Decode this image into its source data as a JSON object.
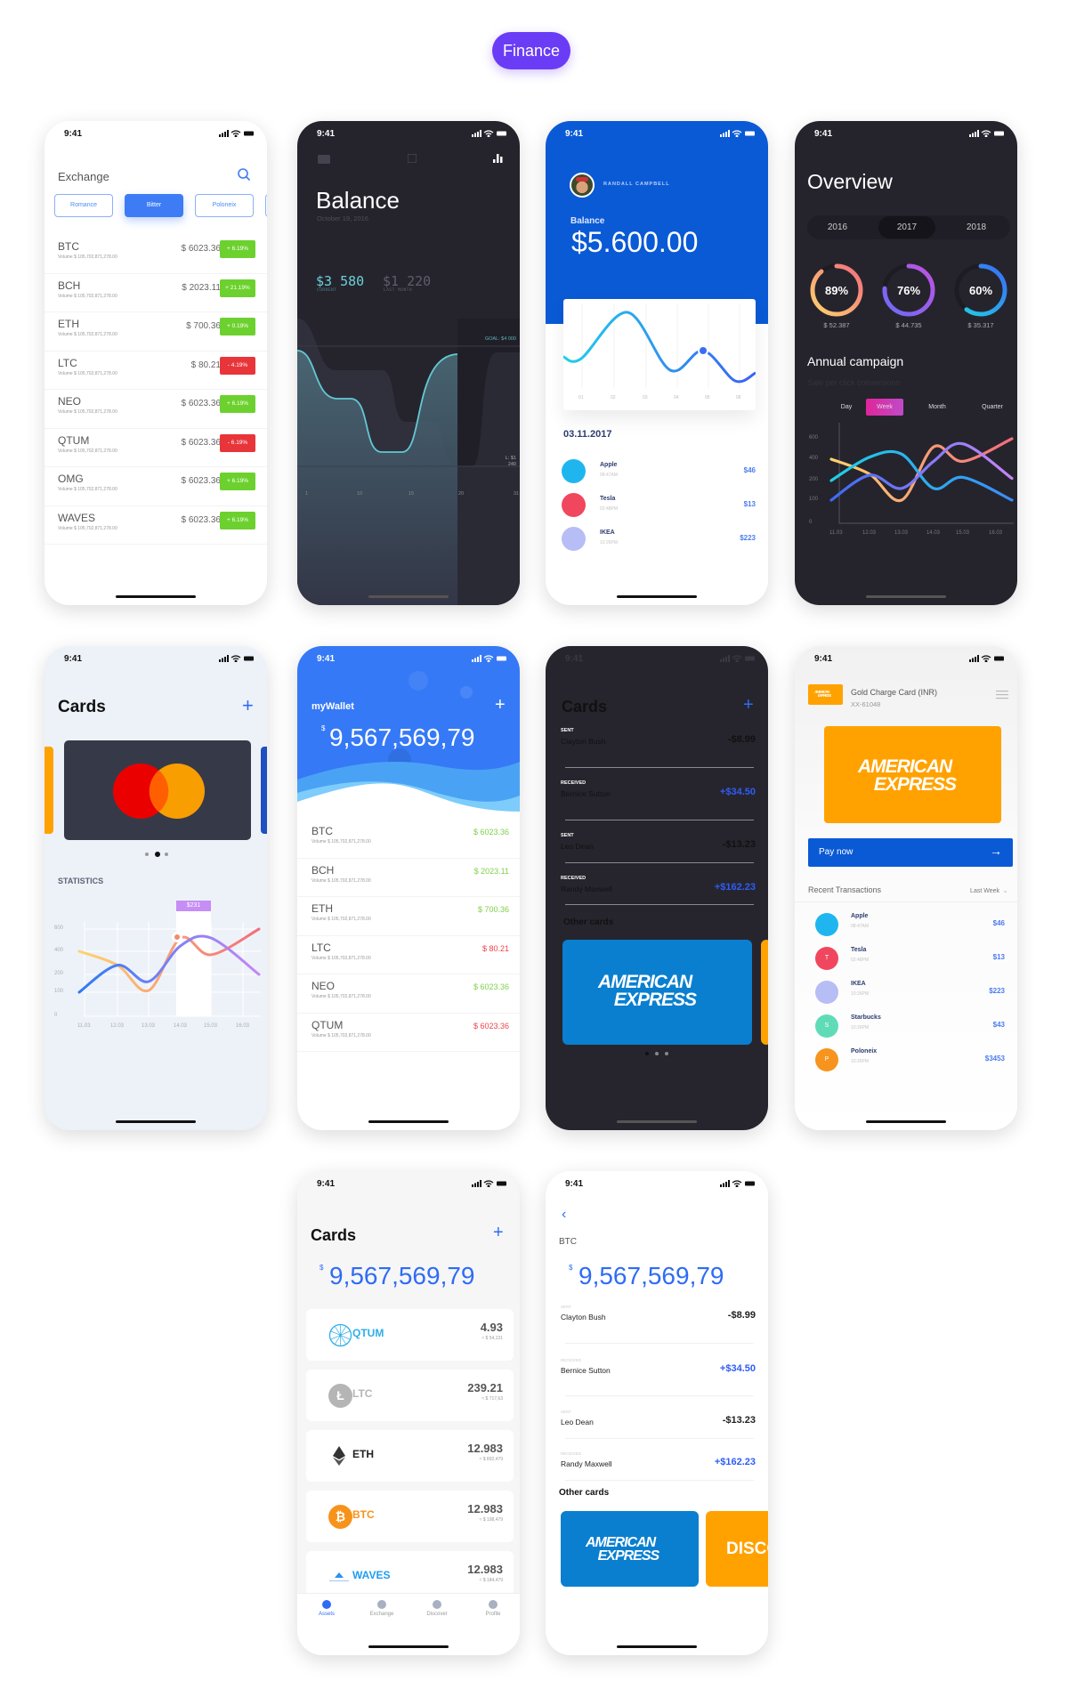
{
  "category_badge": "Finance",
  "status_time": "9:41",
  "colors": {
    "accent_blue": "#3478f6",
    "up_green": "#6cd12e",
    "down_red": "#e8353a",
    "badge_purple": "#6a3cf6",
    "amex_blue": "#0a7fcf",
    "amex_orange": "#ffa200"
  },
  "amex_logo": {
    "line1": "AMERICAN",
    "line2": "EXPRESS"
  },
  "exchange": {
    "title": "Exchange",
    "tabs": [
      "Romance",
      "Bitter",
      "Poloneix"
    ],
    "active_tab": 1,
    "rows": [
      {
        "symbol": "BTC",
        "volume": "Volume $ 105,702,871,278.00",
        "price": "$ 6023.36",
        "change": "+ 6.19%",
        "trend": "up"
      },
      {
        "symbol": "BCH",
        "volume": "Volume $ 105,702,871,278.00",
        "price": "$ 2023.11",
        "change": "+ 21.19%",
        "trend": "up"
      },
      {
        "symbol": "ETH",
        "volume": "Volume $ 105,702,871,278.00",
        "price": "$ 700.36",
        "change": "+ 0.19%",
        "trend": "up"
      },
      {
        "symbol": "LTC",
        "volume": "Volume $ 105,702,871,278.00",
        "price": "$ 80.21",
        "change": "- 4.19%",
        "trend": "down"
      },
      {
        "symbol": "NEO",
        "volume": "Volume $ 105,702,871,278.00",
        "price": "$ 6023.36",
        "change": "+ 6.19%",
        "trend": "up"
      },
      {
        "symbol": "QTUM",
        "volume": "Volume $ 105,702,871,278.00",
        "price": "$ 6023.36",
        "change": "- 6.19%",
        "trend": "down"
      },
      {
        "symbol": "OMG",
        "volume": "Volume $ 105,702,871,278.00",
        "price": "$ 6023.36",
        "change": "+ 6.19%",
        "trend": "up"
      },
      {
        "symbol": "WAVES",
        "volume": "Volume $ 105,702,871,278.00",
        "price": "$ 6023.36",
        "change": "+ 6.19%",
        "trend": "up"
      }
    ]
  },
  "balance": {
    "title": "Balance",
    "date": "October 19, 2016",
    "current_value": "$3 580",
    "current_label": "CURRENT",
    "last_value": "$1 220",
    "last_label": "LAST MONTH",
    "goal_label": "GOAL: $4 000",
    "low_label": "L: $1 240",
    "x_labels": [
      "1",
      "10",
      "15",
      "20",
      "31"
    ]
  },
  "profile": {
    "user_name": "RANDALL CAMPBELL",
    "balance_label": "Balance",
    "balance_value": "$5.600.00",
    "chart_x_labels": [
      "01",
      "02",
      "03",
      "04",
      "05",
      "06"
    ],
    "date": "03.11.2017",
    "transactions": [
      {
        "name": "Apple",
        "time": "08:47AM",
        "amount": "$46",
        "icon": "apple-icon",
        "color": "#1fb6f0"
      },
      {
        "name": "Tesla",
        "time": "02:48PM",
        "amount": "$13",
        "icon": "tesla-icon",
        "color": "#f0475e"
      },
      {
        "name": "IKEA",
        "time": "10:26PM",
        "amount": "$223",
        "icon": "ikea-icon",
        "color": "#b7bdf5"
      }
    ]
  },
  "overview": {
    "title": "Overview",
    "years": [
      "2016",
      "2017",
      "2018"
    ],
    "active_year": 1,
    "rings": [
      {
        "percent": 89,
        "label": "89%",
        "amount": "$ 52.387",
        "colors": [
          "#ffd36e",
          "#f26d7d"
        ]
      },
      {
        "percent": 76,
        "label": "76%",
        "amount": "$ 44.735",
        "colors": [
          "#6c6cf7",
          "#c052e0"
        ]
      },
      {
        "percent": 60,
        "label": "60%",
        "amount": "$ 35.317",
        "colors": [
          "#1fd1e8",
          "#3b6cf5"
        ]
      }
    ],
    "campaign_title": "Annual campaign",
    "campaign_subtitle": "Sale per click conversions",
    "periods": [
      "Day",
      "Week",
      "Month",
      "Quarter"
    ],
    "active_period": 1
  },
  "cards_stats": {
    "title": "Cards",
    "add_label": "+",
    "stats_title": "STATISTICS",
    "tooltip": "$231",
    "carousel_pages": 3,
    "carousel_active": 1
  },
  "wallet": {
    "title": "myWallet",
    "add_label": "+",
    "currency": "$",
    "total": "9,567,569,79",
    "rows": [
      {
        "symbol": "BTC",
        "volume": "Volume $ 105,702,871,278.00",
        "price": "$ 6023.36",
        "trend": "up"
      },
      {
        "symbol": "BCH",
        "volume": "Volume $ 105,702,871,278.00",
        "price": "$ 2023.11",
        "trend": "up"
      },
      {
        "symbol": "ETH",
        "volume": "Volume $ 105,702,871,278.00",
        "price": "$ 700.36",
        "trend": "up"
      },
      {
        "symbol": "LTC",
        "volume": "Volume $ 105,702,871,278.00",
        "price": "$ 80.21",
        "trend": "down"
      },
      {
        "symbol": "NEO",
        "volume": "Volume $ 105,702,871,278.00",
        "price": "$ 6023.36",
        "trend": "up"
      },
      {
        "symbol": "QTUM",
        "volume": "Volume $ 105,702,871,278.00",
        "price": "$ 6023.36",
        "trend": "down"
      }
    ]
  },
  "cards_dark": {
    "title": "Cards",
    "add_label": "+",
    "other_cards_title": "Other cards",
    "transactions": [
      {
        "type": "SENT",
        "name": "Clayton Bush",
        "amount": "-$8.99",
        "direction": "out"
      },
      {
        "type": "RECEIVED",
        "name": "Bernice Sutton",
        "amount": "+$34.50",
        "direction": "in"
      },
      {
        "type": "SENT",
        "name": "Leo Dean",
        "amount": "-$13.23",
        "direction": "out"
      },
      {
        "type": "RECEIVED",
        "name": "Randy Maxwell",
        "amount": "+$162.23",
        "direction": "in"
      }
    ]
  },
  "gold_card": {
    "card_name": "Gold Charge Card (INR)",
    "card_number": "XX-61048",
    "pay_button": "Pay now",
    "recent_title": "Recent Transactions",
    "filter": "Last Week",
    "transactions": [
      {
        "name": "Apple",
        "time": "08:47AM",
        "amount": "$46",
        "icon": "apple-icon",
        "color": "#1fb6f0",
        "glyph": ""
      },
      {
        "name": "Tesla",
        "time": "02:48PM",
        "amount": "$13",
        "icon": "tesla-icon",
        "color": "#f0475e",
        "glyph": "T"
      },
      {
        "name": "IKEA",
        "time": "10:26PM",
        "amount": "$223",
        "icon": "ikea-icon",
        "color": "#b7bdf5",
        "glyph": ""
      },
      {
        "name": "Starbucks",
        "time": "10:26PM",
        "amount": "$43",
        "icon": "starbucks-icon",
        "color": "#5fdcb7",
        "glyph": "S"
      },
      {
        "name": "Poloneix",
        "time": "10:26PM",
        "amount": "$3453",
        "icon": "poloneix-icon",
        "color": "#f7941d",
        "glyph": "P"
      }
    ]
  },
  "assets": {
    "title": "Cards",
    "add_label": "+",
    "currency": "$",
    "total": "9,567,569,79",
    "coins": [
      {
        "symbol": "QTUM",
        "amount": "4.93",
        "fiat": "≈ $ 54,131",
        "color": "#2eaee8",
        "icon": "qtum-icon"
      },
      {
        "symbol": "LTC",
        "amount": "239.21",
        "fiat": "≈ $ 717,63",
        "color": "#b5b5b5",
        "icon": "litecoin-icon"
      },
      {
        "symbol": "ETH",
        "amount": "12.983",
        "fiat": "≈ $ 892,479",
        "color": "#222222",
        "icon": "ethereum-icon"
      },
      {
        "symbol": "BTC",
        "amount": "12.983",
        "fiat": "≈ $ 198,479",
        "color": "#f7931a",
        "icon": "bitcoin-icon"
      },
      {
        "symbol": "WAVES",
        "amount": "12.983",
        "fiat": "≈ $ 184,479",
        "color": "#1f9df0",
        "icon": "waves-icon"
      }
    ],
    "tabs": [
      {
        "label": "Assets",
        "icon": "assets-icon"
      },
      {
        "label": "Exchange",
        "icon": "exchange-icon"
      },
      {
        "label": "Discover",
        "icon": "discover-icon"
      },
      {
        "label": "Profile",
        "icon": "profile-icon"
      }
    ],
    "active_tab": 0
  },
  "btc_detail": {
    "coin": "BTC",
    "currency": "$",
    "total": "9,567,569,79",
    "other_cards_title": "Other cards",
    "discover_label": "DISCOVER",
    "transactions": [
      {
        "type": "SENT",
        "name": "Clayton Bush",
        "amount": "-$8.99",
        "direction": "out"
      },
      {
        "type": "RECEIVED",
        "name": "Bernice Sutton",
        "amount": "+$34.50",
        "direction": "in"
      },
      {
        "type": "SENT",
        "name": "Leo Dean",
        "amount": "-$13.23",
        "direction": "out"
      },
      {
        "type": "RECEIVED",
        "name": "Randy Maxwell",
        "amount": "+$162.23",
        "direction": "in"
      }
    ]
  },
  "chart_data": [
    {
      "type": "line",
      "x": [
        "11.03",
        "12.03",
        "13.03",
        "14.03",
        "15.03",
        "16.03"
      ],
      "y_ticks": [
        0,
        100,
        200,
        400,
        600
      ],
      "series": [
        {
          "values": [
            400,
            260,
            100,
            520,
            380,
            620
          ],
          "colors": [
            "#ffd36e",
            "#f26d7d"
          ]
        },
        {
          "values": [
            200,
            420,
            450,
            160,
            230,
            100
          ],
          "colors": [
            "#1fd1e8",
            "#3b8cf5"
          ]
        },
        {
          "values": [
            100,
            250,
            160,
            380,
            550,
            220
          ],
          "colors": [
            "#3b6cf5",
            "#c586f5"
          ]
        }
      ]
    },
    {
      "type": "line",
      "x": [
        "11.03",
        "12.03",
        "13.03",
        "14.03",
        "15.03",
        "16.03"
      ],
      "y_ticks": [
        0,
        100,
        200,
        400,
        600
      ],
      "highlight": "14.03",
      "series": [
        {
          "values": [
            400,
            280,
            110,
            520,
            370,
            600
          ],
          "colors": [
            "#ffd36e",
            "#f26d7d"
          ]
        },
        {
          "values": [
            100,
            280,
            160,
            450,
            520,
            200
          ],
          "colors": [
            "#2f7af5",
            "#c586f5"
          ]
        }
      ]
    }
  ]
}
